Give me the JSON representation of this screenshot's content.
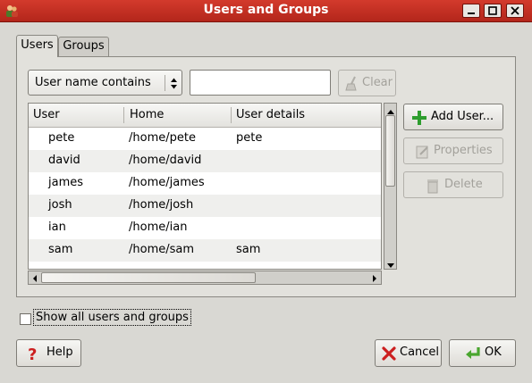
{
  "window": {
    "title": "Users and Groups",
    "icon": "users-groups-app-icon"
  },
  "tabs": [
    {
      "label": "Users",
      "active": true
    },
    {
      "label": "Groups",
      "active": false
    }
  ],
  "filter": {
    "combo_value": "User name contains",
    "search_value": "",
    "clear_label": "Clear"
  },
  "table": {
    "columns": [
      "User",
      "Home",
      "User details"
    ],
    "rows": [
      {
        "user": "pete",
        "home": "/home/pete",
        "details": "pete"
      },
      {
        "user": "david",
        "home": "/home/david",
        "details": ""
      },
      {
        "user": "james",
        "home": "/home/james",
        "details": ""
      },
      {
        "user": "josh",
        "home": "/home/josh",
        "details": ""
      },
      {
        "user": "ian",
        "home": "/home/ian",
        "details": ""
      },
      {
        "user": "sam",
        "home": "/home/sam",
        "details": "sam"
      }
    ]
  },
  "actions": {
    "add_user": "Add User...",
    "properties": "Properties",
    "delete": "Delete"
  },
  "show_all": {
    "label": "Show all users and groups",
    "checked": false
  },
  "footer": {
    "help": "Help",
    "cancel": "Cancel",
    "ok": "OK"
  },
  "colors": {
    "titlebar": "#c4302a",
    "add_icon": "#2e9d2e",
    "cancel_icon": "#cc1f1f",
    "ok_icon": "#4aa62f"
  }
}
